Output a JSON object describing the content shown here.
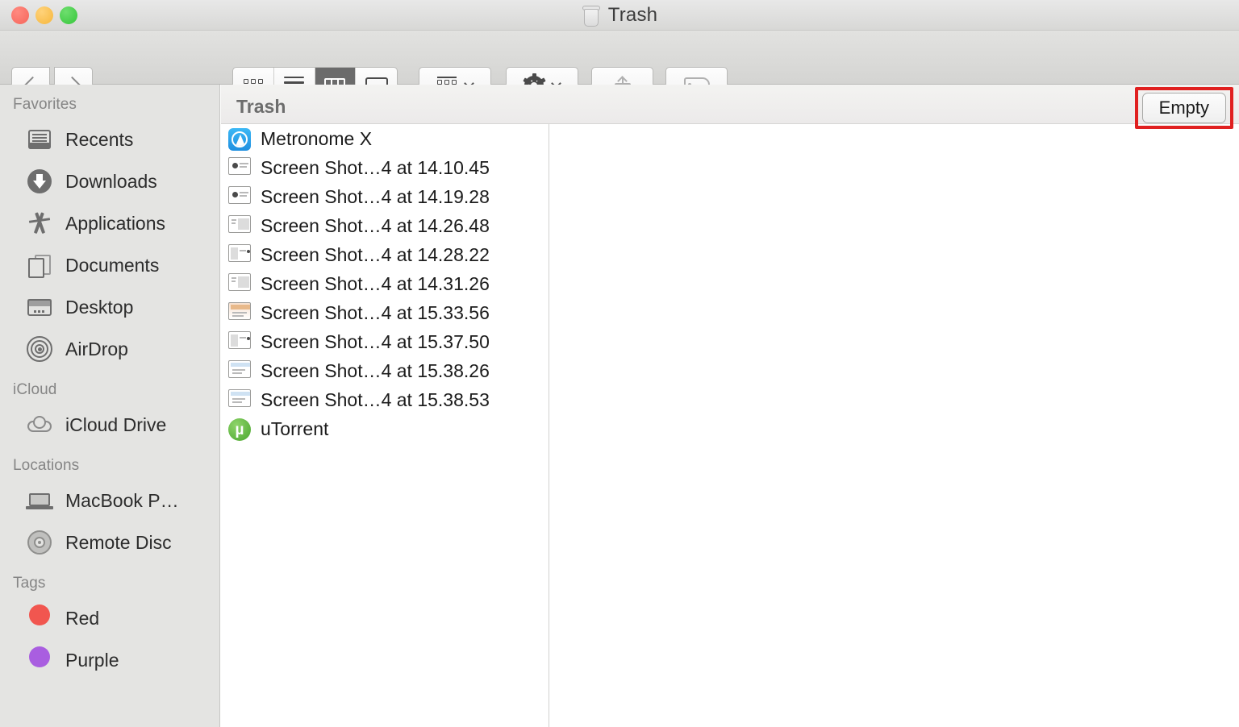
{
  "window": {
    "title": "Trash",
    "title_icon": "trash-icon",
    "traffic_lights": [
      {
        "name": "close",
        "color": "#f6655a"
      },
      {
        "name": "minimize",
        "color": "#f6b73c"
      },
      {
        "name": "maximize",
        "color": "#35c63a"
      }
    ]
  },
  "toolbar": {
    "back": "back-icon",
    "forward": "forward-icon",
    "view_modes": [
      {
        "name": "icon-view",
        "icon": "grid-icon",
        "selected": false
      },
      {
        "name": "list-view",
        "icon": "list-icon",
        "selected": false
      },
      {
        "name": "column-view",
        "icon": "columns-icon",
        "selected": true
      },
      {
        "name": "gallery-view",
        "icon": "gallery-icon",
        "selected": false
      }
    ],
    "arrange": {
      "icon": "arrange-icon",
      "has_dropdown": true
    },
    "action": {
      "icon": "gear-icon",
      "has_dropdown": true
    },
    "share": {
      "icon": "share-icon",
      "enabled": false
    },
    "tag": {
      "icon": "tag-icon",
      "enabled": false
    }
  },
  "sidebar": {
    "sections": [
      {
        "header": "Favorites",
        "items": [
          {
            "label": "Recents",
            "icon": "recents-icon"
          },
          {
            "label": "Downloads",
            "icon": "downloads-icon"
          },
          {
            "label": "Applications",
            "icon": "applications-icon"
          },
          {
            "label": "Documents",
            "icon": "documents-icon"
          },
          {
            "label": "Desktop",
            "icon": "desktop-icon"
          },
          {
            "label": "AirDrop",
            "icon": "airdrop-icon"
          }
        ]
      },
      {
        "header": "iCloud",
        "items": [
          {
            "label": "iCloud Drive",
            "icon": "icloud-drive-icon"
          }
        ]
      },
      {
        "header": "Locations",
        "items": [
          {
            "label": "MacBook P…",
            "icon": "macbook-icon"
          },
          {
            "label": "Remote Disc",
            "icon": "disc-icon"
          }
        ]
      },
      {
        "header": "Tags",
        "items": [
          {
            "label": "Red",
            "icon": "tag-dot-icon",
            "color": "#f1564f"
          },
          {
            "label": "Purple",
            "icon": "tag-dot-icon",
            "color": "#a95ee0"
          }
        ]
      }
    ]
  },
  "pathbar": {
    "title": "Trash",
    "empty_button": "Empty",
    "highlight_color": "#e02020"
  },
  "files": [
    {
      "name": "Metronome X",
      "icon": "metronome-app-icon"
    },
    {
      "name": "Screen Shot…4 at 14.10.45",
      "icon": "screenshot-thumbnail-icon"
    },
    {
      "name": "Screen Shot…4 at 14.19.28",
      "icon": "screenshot-thumbnail-icon"
    },
    {
      "name": "Screen Shot…4 at 14.26.48",
      "icon": "screenshot-thumbnail-icon"
    },
    {
      "name": "Screen Shot…4 at 14.28.22",
      "icon": "screenshot-thumbnail-icon"
    },
    {
      "name": "Screen Shot…4 at 14.31.26",
      "icon": "screenshot-thumbnail-icon"
    },
    {
      "name": "Screen Shot…4 at 15.33.56",
      "icon": "screenshot-thumbnail-icon"
    },
    {
      "name": "Screen Shot…4 at 15.37.50",
      "icon": "screenshot-thumbnail-icon"
    },
    {
      "name": "Screen Shot…4 at 15.38.26",
      "icon": "screenshot-thumbnail-icon"
    },
    {
      "name": "Screen Shot…4 at 15.38.53",
      "icon": "screenshot-thumbnail-icon"
    },
    {
      "name": "uTorrent",
      "icon": "utorrent-app-icon",
      "glyph": "µ"
    }
  ]
}
